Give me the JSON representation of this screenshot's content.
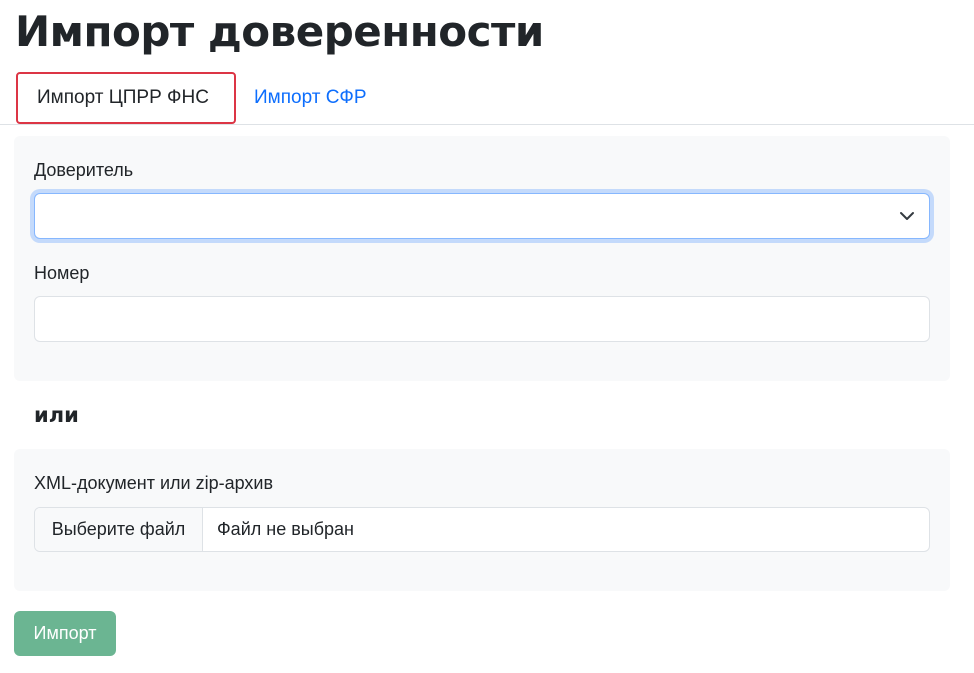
{
  "page": {
    "title": "Импорт доверенности"
  },
  "tabs": [
    {
      "label": "Импорт ЦПРР ФНС",
      "active": true
    },
    {
      "label": "Импорт СФР",
      "active": false
    }
  ],
  "form": {
    "principal": {
      "label": "Доверитель",
      "value": ""
    },
    "number": {
      "label": "Номер",
      "value": "",
      "placeholder": ""
    }
  },
  "separator": {
    "text": "или"
  },
  "file_upload": {
    "label": "XML-документ или zip-архив",
    "button_label": "Выберите файл",
    "status": "Файл не выбран"
  },
  "actions": {
    "import_label": "Импорт"
  },
  "colors": {
    "active_tab_border": "#dc3545",
    "link": "#0d6efd",
    "import_button": "#6bb592",
    "card_background": "#f8f9fa",
    "focus_ring": "#86b7fe"
  },
  "icons": {
    "select_arrow": "chevron-down-icon"
  }
}
